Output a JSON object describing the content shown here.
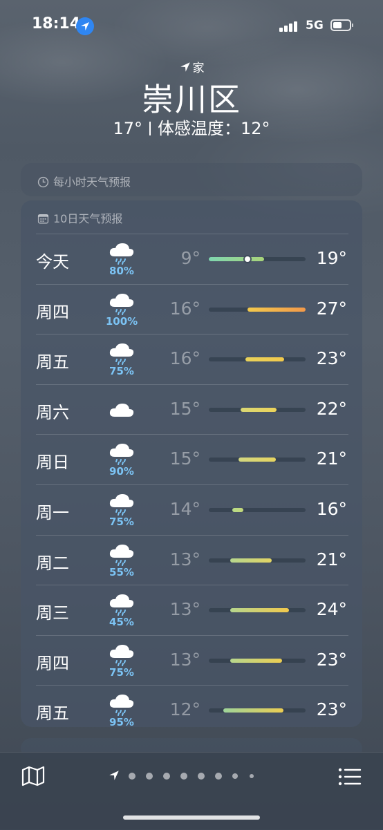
{
  "status_bar": {
    "time": "18:14",
    "network": "5G"
  },
  "location": {
    "home_label": "家",
    "city": "崇川区",
    "current_temp": "17°",
    "feels_like": "体感温度：12°"
  },
  "hourly_card": {
    "title": "每小时天气预报"
  },
  "daily_card": {
    "title": "10日天气预报",
    "days": [
      {
        "day": "今天",
        "icon": "rain-cloud-icon",
        "precip": "80%",
        "low": "9°",
        "high": "19°",
        "range": [
          0.0,
          0.57
        ],
        "current_marker": 0.4,
        "colors": [
          "#7fd6b0",
          "#a8d47a"
        ]
      },
      {
        "day": "周四",
        "icon": "rain-cloud-icon",
        "precip": "100%",
        "low": "16°",
        "high": "27°",
        "range": [
          0.4,
          1.0
        ],
        "colors": [
          "#f2c94c",
          "#f2994a"
        ]
      },
      {
        "day": "周五",
        "icon": "rain-cloud-icon",
        "precip": "75%",
        "low": "16°",
        "high": "23°",
        "range": [
          0.38,
          0.78
        ],
        "colors": [
          "#e8d25a",
          "#f2c94c"
        ]
      },
      {
        "day": "周六",
        "icon": "cloud-icon",
        "precip": "",
        "low": "15°",
        "high": "22°",
        "range": [
          0.33,
          0.7
        ],
        "colors": [
          "#d9d774",
          "#ecd35a"
        ]
      },
      {
        "day": "周日",
        "icon": "rain-cloud-icon",
        "precip": "90%",
        "low": "15°",
        "high": "21°",
        "range": [
          0.31,
          0.69
        ],
        "colors": [
          "#d2d780",
          "#e6d460"
        ]
      },
      {
        "day": "周一",
        "icon": "rain-cloud-icon",
        "precip": "75%",
        "low": "14°",
        "high": "16°",
        "range": [
          0.24,
          0.36
        ],
        "colors": [
          "#b8dc88",
          "#c4d87a"
        ]
      },
      {
        "day": "周二",
        "icon": "rain-cloud-icon",
        "precip": "55%",
        "low": "13°",
        "high": "21°",
        "range": [
          0.22,
          0.65
        ],
        "colors": [
          "#b6d68e",
          "#e2d464"
        ]
      },
      {
        "day": "周三",
        "icon": "rain-cloud-icon",
        "precip": "45%",
        "low": "13°",
        "high": "24°",
        "range": [
          0.22,
          0.83
        ],
        "colors": [
          "#b6d68e",
          "#f2c94c"
        ]
      },
      {
        "day": "周四",
        "icon": "rain-cloud-icon",
        "precip": "75%",
        "low": "13°",
        "high": "23°",
        "range": [
          0.22,
          0.76
        ],
        "colors": [
          "#b6d68e",
          "#eccd52"
        ]
      },
      {
        "day": "周五",
        "icon": "rain-cloud-icon",
        "precip": "95%",
        "low": "12°",
        "high": "23°",
        "range": [
          0.15,
          0.77
        ],
        "colors": [
          "#9ed49a",
          "#eccd52"
        ]
      }
    ]
  },
  "pager": {
    "count": 8,
    "active": 0
  },
  "icons": {
    "map": "map-icon",
    "list": "list-icon",
    "location": "location-arrow-icon"
  }
}
